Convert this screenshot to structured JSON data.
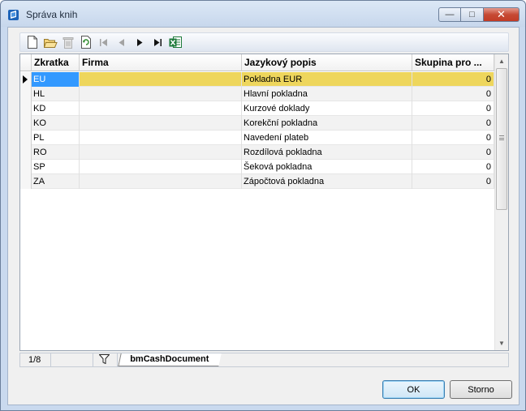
{
  "window": {
    "title": "Správa knih",
    "controls": {
      "minimize": "—",
      "maximize": "□",
      "close": "✕"
    }
  },
  "toolbar": {
    "buttons": [
      {
        "name": "new-icon",
        "enabled": true
      },
      {
        "name": "open-folder-icon",
        "enabled": true
      },
      {
        "name": "delete-icon",
        "enabled": false
      },
      {
        "name": "refresh-icon",
        "enabled": true
      },
      {
        "name": "first-record-icon",
        "enabled": false
      },
      {
        "name": "previous-record-icon",
        "enabled": false
      },
      {
        "name": "next-record-icon",
        "enabled": true
      },
      {
        "name": "last-record-icon",
        "enabled": true
      },
      {
        "name": "excel-export-icon",
        "enabled": true
      }
    ]
  },
  "grid": {
    "columns": [
      "Zkratka",
      "Firma",
      "Jazykový popis",
      "Skupina pro ..."
    ],
    "rows": [
      {
        "code": "EU",
        "company": "",
        "description": "Pokladna EUR",
        "group": "0",
        "selected": true
      },
      {
        "code": "HL",
        "company": "",
        "description": "Hlavní pokladna",
        "group": "0"
      },
      {
        "code": "KD",
        "company": "",
        "description": "Kurzové doklady",
        "group": "0"
      },
      {
        "code": "KO",
        "company": "",
        "description": "Korekční pokladna",
        "group": "0"
      },
      {
        "code": "PL",
        "company": "",
        "description": "Navedení plateb",
        "group": "0"
      },
      {
        "code": "RO",
        "company": "",
        "description": "Rozdílová pokladna",
        "group": "0"
      },
      {
        "code": "SP",
        "company": "",
        "description": "Šeková pokladna",
        "group": "0"
      },
      {
        "code": "ZA",
        "company": "",
        "description": "Zápočtová pokladna",
        "group": "0"
      }
    ],
    "scroll_arrows": {
      "up": "▲",
      "down": "▼"
    }
  },
  "statusbar": {
    "record_position": "1/8",
    "filter_icon": "filter-icon",
    "tab_label": "bmCashDocument"
  },
  "buttons": {
    "ok": "OK",
    "cancel": "Storno"
  },
  "colors": {
    "selected_row": "#eed65c",
    "selected_cell": "#3399ff",
    "window_frame": "#c9d9ee",
    "close_button": "#c64a34"
  }
}
